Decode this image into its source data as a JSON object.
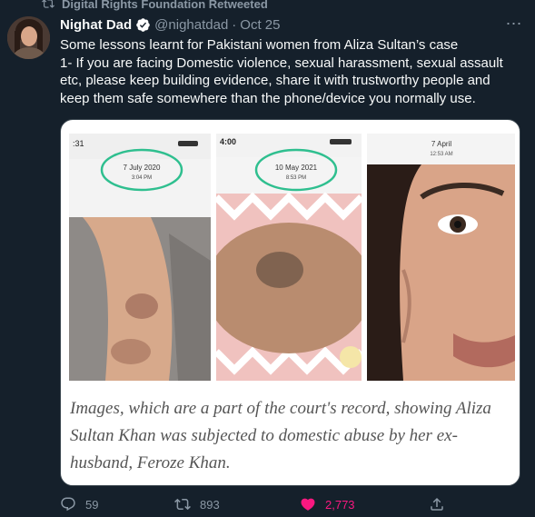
{
  "retweet": {
    "label": "Digital Rights Foundation Retweeted"
  },
  "author": {
    "name": "Nighat Dad",
    "handle": "@nighatdad",
    "separator": "·",
    "date": "Oct 25"
  },
  "tweet": {
    "lines": [
      "Some lessons learnt for Pakistani women from Aliza Sultan’s case",
      "1- If you are facing Domestic violence, sexual harassment, sexual assault",
      "etc, please keep building evidence, share it with trustworthy people and",
      "keep them safe somewhere than the phone/device you normally use."
    ]
  },
  "media": {
    "photos": [
      {
        "status_time": ":31",
        "date": "7 July 2020",
        "time": "3:04 PM"
      },
      {
        "status_time": "4:00",
        "date": "10 May 2021",
        "time": "8:53 PM"
      },
      {
        "status_time": "",
        "date": "7 April",
        "time": "12:53 AM"
      }
    ],
    "caption_lines": [
      "Images, which are a part of the court's record, showing Aliza",
      "Sultan Khan was subjected to domestic abuse by her ex-",
      "husband, Feroze Khan."
    ]
  },
  "actions": {
    "replies": "59",
    "retweets": "893",
    "likes": "2,773"
  },
  "colors": {
    "background": "#15202b",
    "primary_text": "#f7f9f9",
    "secondary_text": "#8b98a5",
    "verified": "#1d9bf0",
    "like": "#f91880",
    "circle_annotation": "#2fbf8f"
  },
  "icons": {
    "retweet_header": "retweet-icon",
    "verified": "verified-badge-icon",
    "more": "more-options-icon",
    "reply": "reply-icon",
    "retweet": "retweet-icon",
    "like": "heart-filled-icon",
    "share": "share-icon"
  }
}
